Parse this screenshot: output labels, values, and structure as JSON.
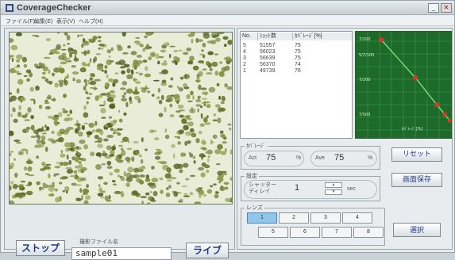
{
  "window": {
    "title": "CoverageChecker"
  },
  "menu": [
    "ファイル(F)",
    "編集(E)",
    "表示(V)",
    "ヘルプ(H)"
  ],
  "left": {
    "stop_label": "ストップ",
    "live_label": "ライブ",
    "filename_label": "撮影ファイル名",
    "filename_value": "sample01"
  },
  "table": {
    "headers": [
      "No.",
      "ｼｮｯﾄ数",
      "ｶﾊﾞﾚｰｼﾞ[%]"
    ],
    "rows": [
      [
        "5",
        "51557",
        "75"
      ],
      [
        "4",
        "56023",
        "75"
      ],
      [
        "3",
        "56639",
        "75"
      ],
      [
        "2",
        "56370",
        "74"
      ],
      [
        "1",
        "49739",
        "76"
      ]
    ]
  },
  "graph": {
    "labels": [
      "7/100",
      "5/7/100",
      "7/200",
      "7/500",
      "ｶﾊﾞﾚｰｼﾞ[%]"
    ]
  },
  "coverage": {
    "group_label": "ｶﾊﾞﾚｰｼﾞ",
    "act_label": "Act",
    "act_value": "75",
    "ave_label": "Ave",
    "ave_value": "75",
    "unit": "%"
  },
  "settings": {
    "group_label": "設定",
    "shutter_label": "シャッター\nディレイ",
    "shutter_value": "1",
    "unit": "sec"
  },
  "lens": {
    "group_label": "レンズ",
    "row1": [
      "1",
      "2",
      "3",
      "4"
    ],
    "row2": [
      "5",
      "6",
      "7",
      "8"
    ],
    "selected": "1"
  },
  "buttons": {
    "reset": "リセット",
    "save": "画面保存",
    "select": "選択"
  },
  "colors": {
    "graph_bg": "#1d6a2a",
    "graph_line": "#4caf50",
    "point": "#d83a2a",
    "lens_selected": "#8fc6ea",
    "button_text": "#1e3b88"
  }
}
